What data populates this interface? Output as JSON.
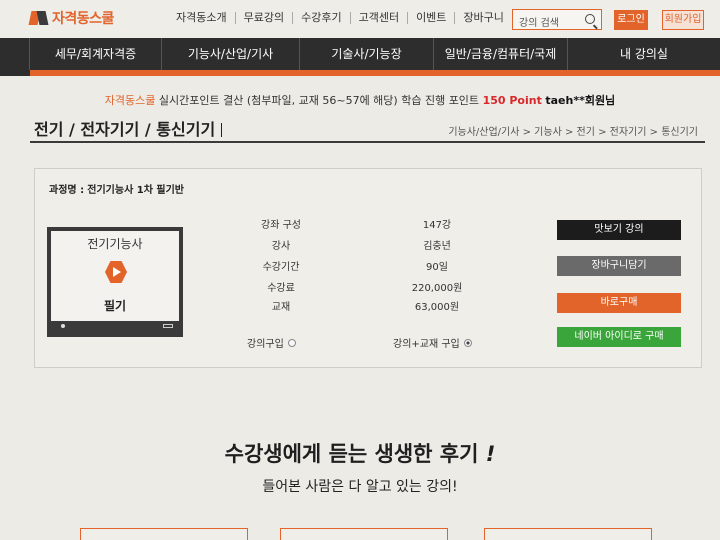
{
  "header": {
    "logo": "자격동스쿨",
    "topnav": [
      "자격동소개",
      "무료강의",
      "수강후기",
      "고객센터",
      "이벤트",
      "장바구니"
    ],
    "search_placeholder": "강의 검색",
    "login_label": "로그인",
    "join_label": "회원가입"
  },
  "mainnav": [
    "세무/회계자격증",
    "기능사/산업/기사",
    "기술사/기능장",
    "일반/금융/컴퓨터/국제",
    "내 강의실"
  ],
  "notice": {
    "brand": "자격동스쿨",
    "text": "실시간포인트 결산 (첨부파일, 교재 56~57에 해당) 학습 진행 포인트",
    "points": "150 Point",
    "user": "taeh**회원님"
  },
  "page": {
    "title": "전기 / 전자기기 / 통신기기",
    "breadcrumb": "기능사/산업/기사 > 기능사 > 전기 > 전자기기 > 통신기기"
  },
  "course": {
    "name_label": "과정명 :",
    "name_value": "전기기능사 1차 필기반",
    "thumb_title": "전기기능사",
    "thumb_subtitle": "필기",
    "info": [
      {
        "label": "강좌 구성",
        "value": "147강"
      },
      {
        "label": "강사",
        "value": "김충년"
      },
      {
        "label": "수강기간",
        "value": "90일"
      },
      {
        "label": "수강료",
        "value": "220,000원"
      },
      {
        "label": "교재",
        "value": "63,000원"
      }
    ],
    "option_lecture": "강의구입",
    "option_lecture_book": "강의+교재 구입",
    "selected_option": "강의+교재 구입",
    "buttons": {
      "preview": "맛보기 강의",
      "cart": "장바구니담기",
      "buy": "바로구매",
      "naver": "네이버 아이디로 구매"
    }
  },
  "reviews": {
    "title": "수강생에게 듣는 생생한 후기",
    "title_mark": "!",
    "subtitle": "들어본 사람은 다 알고 있는 강의",
    "subtitle_mark": "!"
  },
  "colors": {
    "accent": "#e2642b",
    "nav_bg": "#2d2d2d",
    "preview_btn": "#1c1c1c",
    "cart_btn": "#6a6a6a",
    "naver_btn": "#3aa53a",
    "points_red": "#d8282b"
  }
}
